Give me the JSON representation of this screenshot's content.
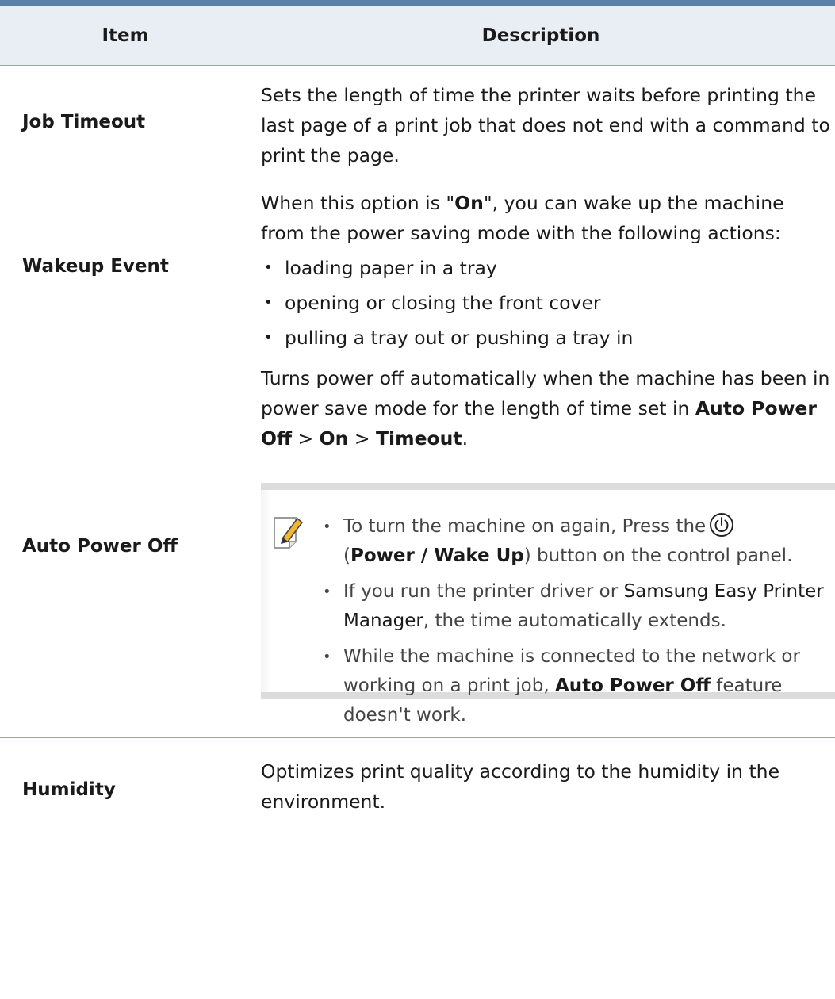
{
  "header": {
    "col_item": "Item",
    "col_description": "Description"
  },
  "rows": {
    "job_timeout": {
      "item": "Job Timeout",
      "description": "Sets the length of time the printer waits before printing the last page of a print job that does not end with a command to print the page."
    },
    "wakeup_event": {
      "item": "Wakeup Event",
      "intro_1": "When this option is \"",
      "intro_bold": "On",
      "intro_2": "\", you can wake up the machine from the power saving mode with the following actions:",
      "bullets": [
        "loading paper in a tray",
        "opening or closing the front cover",
        "pulling a tray out or pushing a tray in"
      ]
    },
    "auto_power_off": {
      "item": "Auto Power Off",
      "desc_1": "Turns power off automatically when the machine has been in power save mode for the length of time set in ",
      "path_1": "Auto Power Off",
      "sep_1": " > ",
      "path_2": "On",
      "sep_2": " > ",
      "path_3": "Timeout",
      "desc_end": ".",
      "note": {
        "b1_text": "To turn the machine on again, Press the",
        "b1_paren_open": "(",
        "b1_bold": "Power / Wake Up",
        "b1_rest": ") button on the control panel.",
        "b2_a": "If you run the printer driver or ",
        "b2_link": "Samsung Easy Printer Manager",
        "b2_b": ", the time automatically extends.",
        "b3_a": "While the machine is connected to the network or working on a print job, ",
        "b3_bold": "Auto Power Off",
        "b3_b": " feature doesn't work."
      }
    },
    "humidity": {
      "item": "Humidity",
      "description": "Optimizes print quality according to the humidity in the environment."
    }
  },
  "icons": {
    "note": "note-pencil-icon",
    "power": "power-icon"
  },
  "colors": {
    "header_bar": "#5a7fa8",
    "header_bg": "#e9eef4",
    "border": "#8fa7c2"
  }
}
